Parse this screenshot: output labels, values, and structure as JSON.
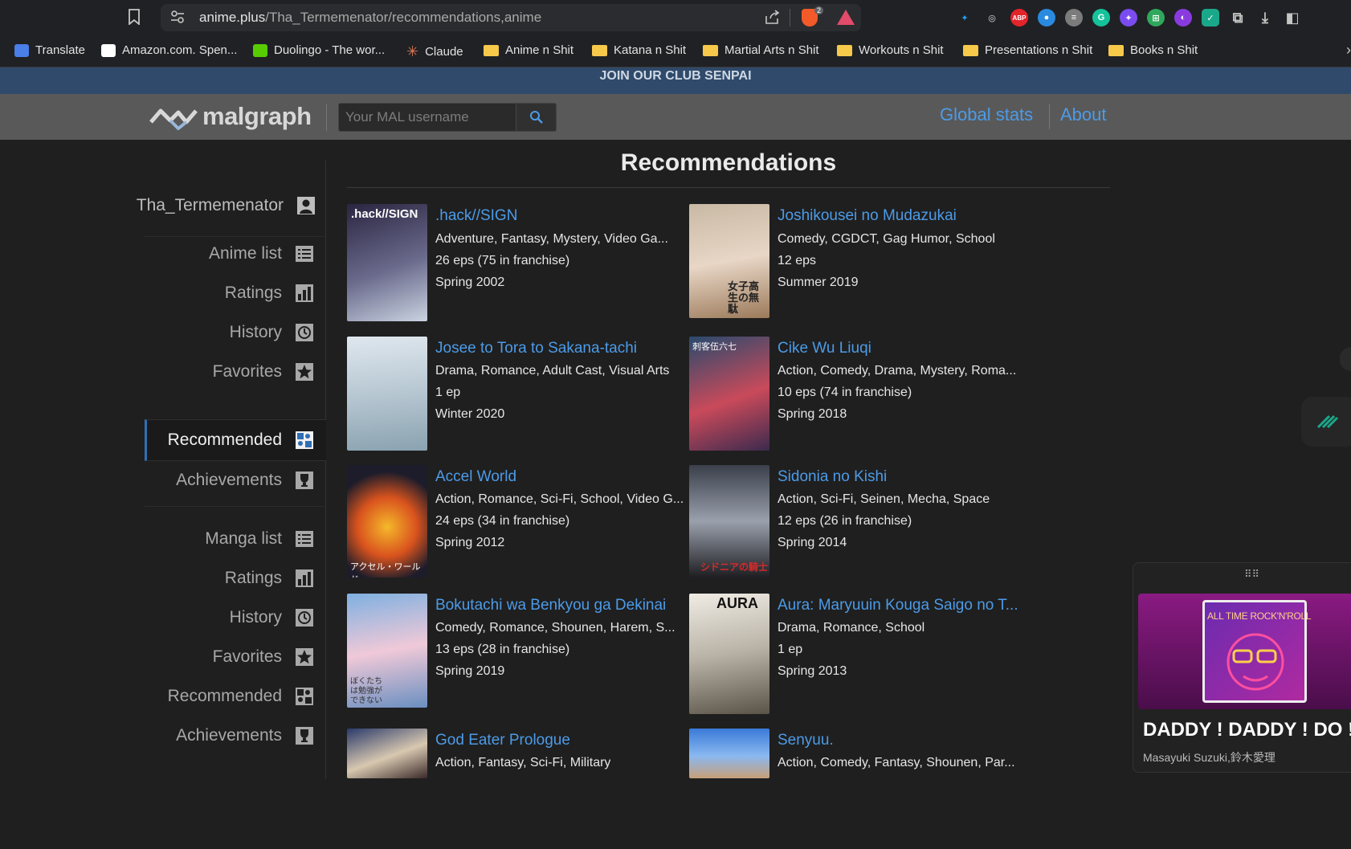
{
  "browser": {
    "url_domain": "anime.plus",
    "url_path": "/Tha_Termemenator/recommendations,anime",
    "brave_badge": "2",
    "extensions": [
      "bluesky-icon",
      "glasses-icon",
      "abp-icon",
      "globe-icon",
      "wayback-icon",
      "grammarly-icon",
      "sparkle-icon",
      "puzzle-green-icon",
      "moon-icon",
      "check-icon",
      "extensions-icon",
      "download-icon",
      "sidebar-icon"
    ],
    "ext_abp_label": "ABP",
    "bookmarks": [
      {
        "label": "Translate",
        "icon": "translate-icon",
        "color": "#4a7ee8"
      },
      {
        "label": "Amazon.com. Spen...",
        "icon": "amazon-icon",
        "color": "#ffffff"
      },
      {
        "label": "Duolingo - The wor...",
        "icon": "duolingo-icon",
        "color": "#58cc02"
      },
      {
        "label": "Claude",
        "icon": "claude-icon",
        "color": "#d97757"
      },
      {
        "label": "Anime n Shit",
        "icon": "folder-icon"
      },
      {
        "label": "Katana n Shit",
        "icon": "folder-icon"
      },
      {
        "label": "Martial Arts n Shit",
        "icon": "folder-icon"
      },
      {
        "label": "Workouts n Shit",
        "icon": "folder-icon"
      },
      {
        "label": "Presentations n Shit",
        "icon": "folder-icon"
      },
      {
        "label": "Books n Shit",
        "icon": "folder-icon"
      }
    ]
  },
  "promo": "JOIN OUR CLUB SENPAI",
  "header": {
    "logo_text": "malgraph",
    "search_placeholder": "Your MAL username",
    "nav": [
      "Global stats",
      "About"
    ]
  },
  "sidebar": {
    "username": "Tha_Termemenator",
    "anime": [
      {
        "label": "Anime list",
        "icon": "list-icon"
      },
      {
        "label": "Ratings",
        "icon": "bar-chart-icon"
      },
      {
        "label": "History",
        "icon": "history-icon"
      },
      {
        "label": "Favorites",
        "icon": "star-icon"
      },
      {
        "label": "Recommended",
        "icon": "puzzle-icon",
        "active": true
      },
      {
        "label": "Achievements",
        "icon": "trophy-icon"
      }
    ],
    "manga": [
      {
        "label": "Manga list",
        "icon": "list-icon"
      },
      {
        "label": "Ratings",
        "icon": "bar-chart-icon"
      },
      {
        "label": "History",
        "icon": "history-icon"
      },
      {
        "label": "Favorites",
        "icon": "star-icon"
      },
      {
        "label": "Recommended",
        "icon": "puzzle-icon"
      },
      {
        "label": "Achievements",
        "icon": "trophy-icon"
      }
    ]
  },
  "content": {
    "title": "Recommendations",
    "items": [
      {
        "title": ".hack//SIGN",
        "genres": "Adventure, Fantasy, Mystery, Video Ga...",
        "eps": "26 eps (75 in franchise)",
        "season": "Spring 2002",
        "poster_text": ".hack//SIGN"
      },
      {
        "title": "Joshikousei no Mudazukai",
        "genres": "Comedy, CGDCT, Gag Humor, School",
        "eps": "12 eps",
        "season": "Summer 2019",
        "poster_text": "女子高生の無駄"
      },
      {
        "title": "Josee to Tora to Sakana-tachi",
        "genres": "Drama, Romance, Adult Cast, Visual Arts",
        "eps": "1 ep",
        "season": "Winter 2020",
        "poster_text": ""
      },
      {
        "title": "Cike Wu Liuqi",
        "genres": "Action, Comedy, Drama, Mystery, Roma...",
        "eps": "10 eps (74 in franchise)",
        "season": "Spring 2018",
        "poster_text": "刺客伍六七"
      },
      {
        "title": "Accel World",
        "genres": "Action, Romance, Sci-Fi, School, Video G...",
        "eps": "24 eps (34 in franchise)",
        "season": "Spring 2012",
        "poster_text": "アクセル・ワールド"
      },
      {
        "title": "Sidonia no Kishi",
        "genres": "Action, Sci-Fi, Seinen, Mecha, Space",
        "eps": "12 eps (26 in franchise)",
        "season": "Spring 2014",
        "poster_text": "シドニアの騎士"
      },
      {
        "title": "Bokutachi wa Benkyou ga Dekinai",
        "genres": "Comedy, Romance, Shounen, Harem, S...",
        "eps": "13 eps (28 in franchise)",
        "season": "Spring 2019",
        "poster_text": "ぼくたちは勉強ができない"
      },
      {
        "title": "Aura: Maryuuin Kouga Saigo no T...",
        "genres": "Drama, Romance, School",
        "eps": "1 ep",
        "season": "Spring 2013",
        "poster_text": "AURA"
      },
      {
        "title": "God Eater Prologue",
        "genres": "Action, Fantasy, Sci-Fi, Military",
        "eps": "",
        "season": "",
        "poster_text": ""
      },
      {
        "title": "Senyuu.",
        "genres": "Action, Comedy, Fantasy, Shounen, Par...",
        "eps": "",
        "season": "",
        "poster_text": ""
      }
    ]
  },
  "player": {
    "song": "DADDY ! DADDY ! DO !",
    "artist": "Masayuki Suzuki,鈴木愛理",
    "album_text": "ALL TIME ROCK'N'ROLL"
  }
}
